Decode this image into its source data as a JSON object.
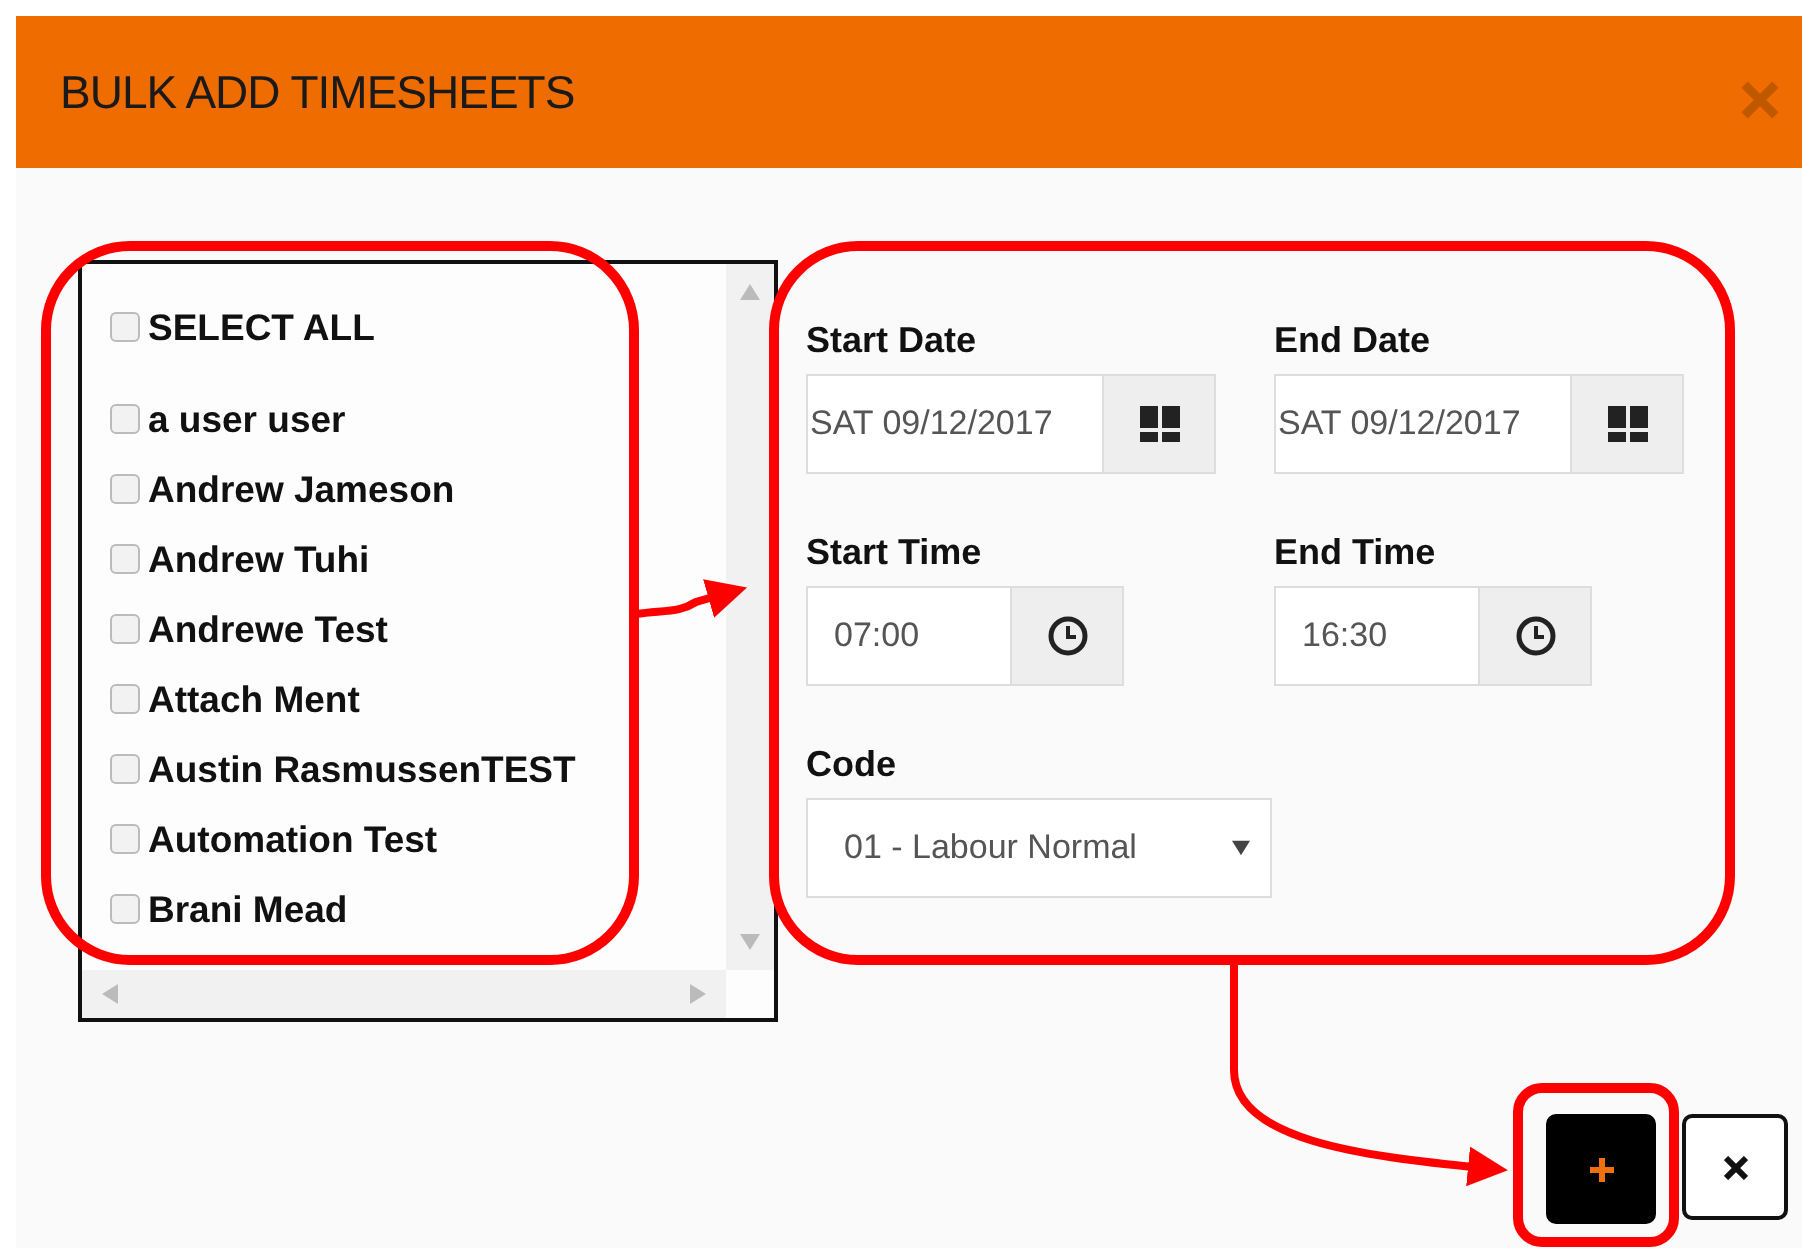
{
  "dialog": {
    "title": "BULK ADD TIMESHEETS"
  },
  "user_list": {
    "select_all": {
      "label": "SELECT ALL",
      "checked": false
    },
    "users": [
      {
        "name": "a user user",
        "checked": false
      },
      {
        "name": "Andrew Jameson",
        "checked": false
      },
      {
        "name": "Andrew Tuhi",
        "checked": false
      },
      {
        "name": "Andrewe Test",
        "checked": false
      },
      {
        "name": "Attach Ment",
        "checked": false
      },
      {
        "name": "Austin RasmussenTEST",
        "checked": false
      },
      {
        "name": "Automation Test",
        "checked": false
      },
      {
        "name": "Brani Mead",
        "checked": false
      }
    ]
  },
  "form": {
    "fields": [
      {
        "kind": "date",
        "label": "Start Date",
        "value": "SAT 09/12/2017"
      },
      {
        "kind": "date",
        "label": "End Date",
        "value": "SAT 09/12/2017"
      },
      {
        "kind": "time",
        "label": "Start Time",
        "value": "07:00"
      },
      {
        "kind": "time",
        "label": "End Time",
        "value": "16:30"
      },
      {
        "kind": "select",
        "label": "Code",
        "value": "01 - Labour Normal"
      }
    ]
  }
}
